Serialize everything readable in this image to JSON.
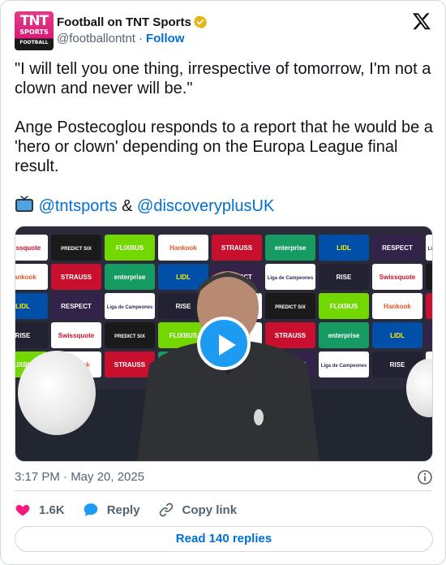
{
  "author": {
    "display_name": "Football on TNT Sports",
    "handle": "@footballontnt",
    "separator": "·",
    "follow_label": "Follow",
    "avatar": {
      "line1": "TNT",
      "line2": "SPORTS",
      "line3": "FOOTBALL"
    }
  },
  "tweet": {
    "quote": "\"I will tell you one thing, irrespective of tomorrow, I'm not a clown and never will be.\"",
    "body": "Ange Postecoglou responds to a report that he would be a 'hero or clown' depending on the Europa League final result.",
    "mention1": "@tntsports",
    "ampersand": "&",
    "mention2": "@discoveryplusUK"
  },
  "media": {
    "type": "video",
    "board_sponsors": [
      "Swissquote",
      "PREDICT SIX",
      "FLIXBUS",
      "Hankook",
      "STRAUSS",
      "enterprise",
      "LIDL",
      "RESPECT",
      "Liga de Campeones",
      "RISE"
    ]
  },
  "timestamp": "3:17 PM · May 20, 2025",
  "actions": {
    "likes": "1.6K",
    "reply_label": "Reply",
    "copy_link_label": "Copy link"
  },
  "read_replies_label": "Read 140 replies",
  "colors": {
    "link": "#006fd6",
    "like": "#f91880",
    "play": "#1d9bf0",
    "muted": "#536471",
    "border": "#cfd9de"
  }
}
